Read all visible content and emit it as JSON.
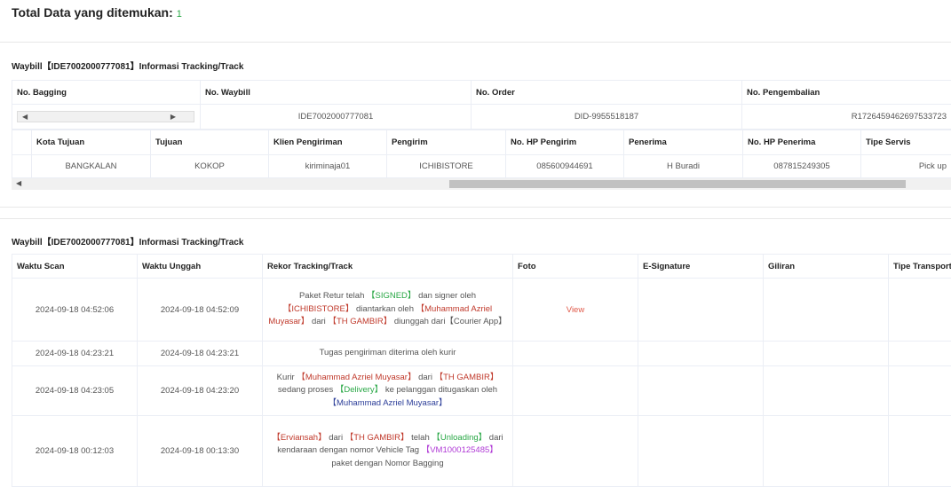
{
  "header": {
    "title": "Total Data yang ditemukan:",
    "count": "1"
  },
  "section1": {
    "title": "Waybill【IDE7002000777081】Informasi Tracking/Track",
    "table1": {
      "headers": [
        "No. Bagging",
        "No. Waybill",
        "No. Order",
        "No. Pengembalian"
      ],
      "row": [
        "",
        "IDE7002000777081",
        "DID-9955518187",
        "R1726459462697533723"
      ]
    },
    "table2": {
      "headers": [
        "",
        "Kota Tujuan",
        "Tujuan",
        "Klien Pengiriman",
        "Pengirim",
        "No. HP Pengirim",
        "Penerima",
        "No. HP Penerima",
        "Tipe Servis"
      ],
      "row": [
        "",
        "BANGKALAN",
        "KOKOP",
        "kiriminaja01",
        "ICHIBISTORE",
        "085600944691",
        "H Buradi",
        "087815249305",
        "Pick up"
      ]
    }
  },
  "section2": {
    "title": "Waybill【IDE7002000777081】Informasi Tracking/Track",
    "headers": [
      "Waktu Scan",
      "Waktu Unggah",
      "Rekor Tracking/Track",
      "Foto",
      "E-Signature",
      "Giliran",
      "Tipe Transport"
    ],
    "rows": [
      {
        "scan": "2024-09-18 04:52:06",
        "upload": "2024-09-18 04:52:09",
        "segments": [
          [
            "Paket Retur telah ",
            ""
          ],
          [
            "【SIGNED】",
            "green"
          ],
          [
            " dan signer oleh ",
            ""
          ],
          [
            "【ICHIBISTORE】",
            "red"
          ],
          [
            " diantarkan oleh ",
            ""
          ],
          [
            "【Muhammad Azriel Muyasar】",
            "red"
          ],
          [
            " dari ",
            ""
          ],
          [
            "【TH GAMBIR】",
            "red"
          ],
          [
            " diunggah dari【Courier App】",
            ""
          ]
        ],
        "foto": "View"
      },
      {
        "scan": "2024-09-18 04:23:21",
        "upload": "2024-09-18 04:23:21",
        "segments": [
          [
            "Tugas pengiriman diterima oleh kurir",
            ""
          ]
        ],
        "foto": ""
      },
      {
        "scan": "2024-09-18 04:23:05",
        "upload": "2024-09-18 04:23:20",
        "segments": [
          [
            "Kurir ",
            ""
          ],
          [
            "【Muhammad Azriel Muyasar】",
            "red"
          ],
          [
            " dari ",
            ""
          ],
          [
            "【TH GAMBIR】",
            "red"
          ],
          [
            " sedang proses ",
            ""
          ],
          [
            "【Delivery】",
            "green"
          ],
          [
            " ke pelanggan ditugaskan oleh ",
            ""
          ],
          [
            "【Muhammad Azriel Muyasar】",
            "blue"
          ]
        ],
        "foto": ""
      },
      {
        "scan": "2024-09-18 00:12:03",
        "upload": "2024-09-18 00:13:30",
        "segments": [
          [
            "【Erviansah】",
            "red"
          ],
          [
            " dari ",
            ""
          ],
          [
            "【TH GAMBIR】",
            "red"
          ],
          [
            " telah ",
            ""
          ],
          [
            "【Unloading】",
            "green"
          ],
          [
            " dari kendaraan dengan nomor Vehicle Tag ",
            ""
          ],
          [
            "【VM1000125485】",
            "purple"
          ],
          [
            " paket dengan Nomor Bagging",
            ""
          ]
        ],
        "foto": ""
      }
    ]
  }
}
